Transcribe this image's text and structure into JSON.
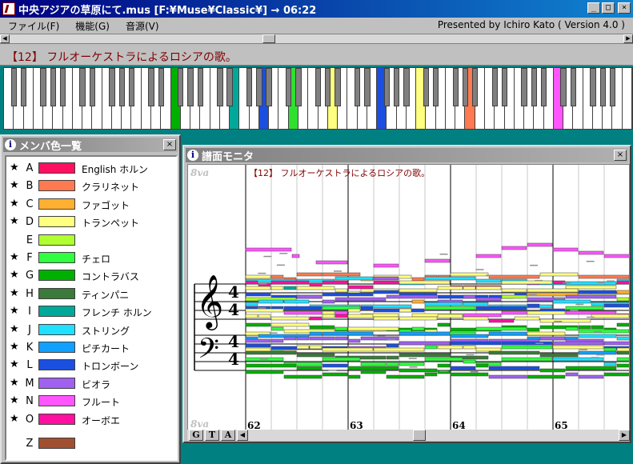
{
  "window": {
    "title": "中央アジアの草原にて.mus [F:¥Muse¥Classic¥] → 06:22",
    "minimize": "_",
    "maximize": "□",
    "close": "×"
  },
  "menu": {
    "items": [
      "ファイル(F)",
      "機能(G)",
      "音源(V)"
    ],
    "credit": "Presented by Ichiro Kato ( Version 4.0 )"
  },
  "song_info": "【12】 フルオーケストラによるロシアの歌。",
  "keyboard": {
    "white_keys": 64,
    "pressed_white": [
      {
        "index": 17,
        "color": "#00b000"
      },
      {
        "index": 23,
        "color": "#00a89a"
      },
      {
        "index": 26,
        "color": "#1a4fe0"
      },
      {
        "index": 29,
        "color": "#30e030"
      },
      {
        "index": 33,
        "color": "#ffff80"
      },
      {
        "index": 38,
        "color": "#1a4fe0"
      },
      {
        "index": 42,
        "color": "#ffff80"
      },
      {
        "index": 47,
        "color": "#ff7a50"
      },
      {
        "index": 56,
        "color": "#ff55ff"
      }
    ]
  },
  "member_window": {
    "title": "メンバ色一覧",
    "close": "×",
    "members": [
      {
        "star": "★",
        "letter": "A",
        "color": "#ff1060",
        "name": "English ホルン"
      },
      {
        "star": "★",
        "letter": "B",
        "color": "#ff7a50",
        "name": "クラリネット"
      },
      {
        "star": "★",
        "letter": "C",
        "color": "#ffb030",
        "name": "ファゴット"
      },
      {
        "star": "★",
        "letter": "D",
        "color": "#ffff80",
        "name": "トランペット"
      },
      {
        "star": "",
        "letter": "E",
        "color": "#b0ff30",
        "name": ""
      },
      {
        "star": "★",
        "letter": "F",
        "color": "#30ff40",
        "name": "チェロ"
      },
      {
        "star": "★",
        "letter": "G",
        "color": "#00b000",
        "name": "コントラバス"
      },
      {
        "star": "★",
        "letter": "H",
        "color": "#3a7a3a",
        "name": "ティンパニ"
      },
      {
        "star": "★",
        "letter": "I",
        "color": "#00a89a",
        "name": "フレンチ ホルン"
      },
      {
        "star": "★",
        "letter": "J",
        "color": "#20e0ff",
        "name": "ストリング"
      },
      {
        "star": "★",
        "letter": "K",
        "color": "#10a0ff",
        "name": "ピチカート"
      },
      {
        "star": "★",
        "letter": "L",
        "color": "#1a4fe0",
        "name": "トロンボーン"
      },
      {
        "star": "★",
        "letter": "M",
        "color": "#a060f0",
        "name": "ビオラ"
      },
      {
        "star": "★",
        "letter": "N",
        "color": "#ff55ff",
        "name": "フルート"
      },
      {
        "star": "★",
        "letter": "O",
        "color": "#ff10a0",
        "name": "オーボエ"
      },
      {
        "star": "",
        "letter": "Z",
        "color": "#a05030",
        "name": ""
      }
    ]
  },
  "score_window": {
    "title": "譜面モニタ",
    "close": "×",
    "caption": "【12】 フルオーケストラによるロシアの歌。",
    "octave_mark": "8va",
    "time_sig_top": "4",
    "time_sig_bottom": "4",
    "measures": [
      "62",
      "63",
      "64",
      "65"
    ],
    "buttons": [
      "G",
      "T",
      "A"
    ]
  }
}
